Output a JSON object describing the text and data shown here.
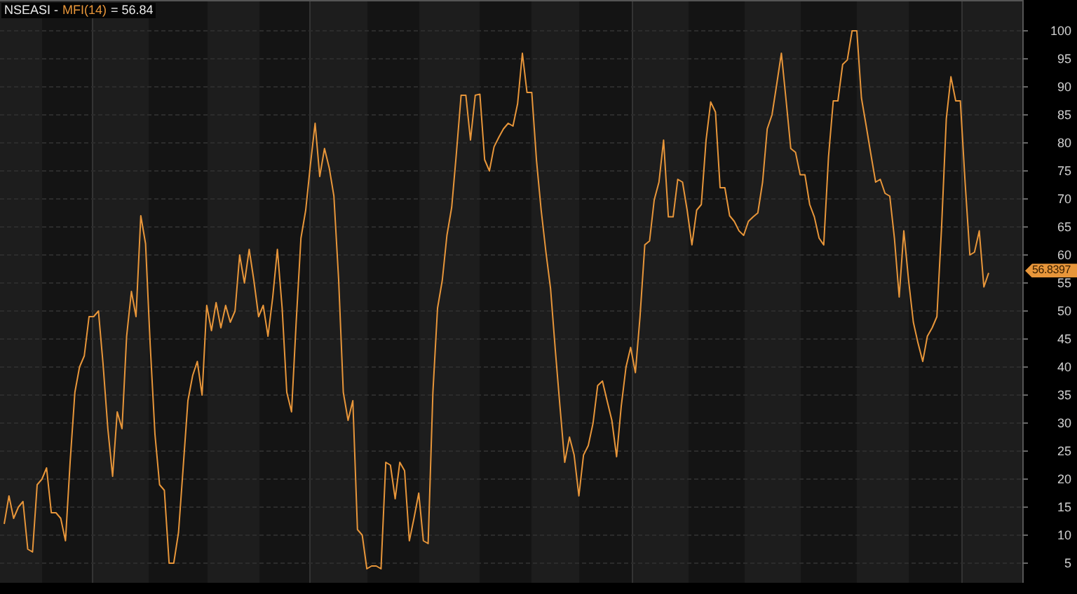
{
  "legend": {
    "symbol": "NSEASI -",
    "reading": "= 56.84"
  },
  "last_value_tag": "56.8397",
  "chart_data": {
    "type": "line",
    "grid": true,
    "ylim": [
      1.5,
      105.5
    ],
    "yticks": [
      5,
      10,
      15,
      20,
      25,
      30,
      35,
      40,
      45,
      50,
      55,
      60,
      65,
      70,
      75,
      80,
      85,
      90,
      95,
      100
    ],
    "series": [
      {
        "name": "MFI(14)",
        "color": "#e8963a",
        "values": [
          12,
          17,
          13,
          15,
          16,
          7.5,
          7,
          19,
          20,
          22,
          14,
          14,
          13,
          9,
          23,
          35.5,
          40,
          42,
          49,
          49,
          50,
          40.5,
          29,
          20.5,
          32,
          29,
          45.5,
          53.5,
          49,
          67,
          62,
          44,
          28,
          19,
          18,
          5,
          5,
          10.5,
          22,
          34,
          38.5,
          41,
          35,
          51,
          46.5,
          51.5,
          47,
          51,
          48,
          50,
          60,
          55,
          61,
          55.5,
          49,
          51,
          45.5,
          52.5,
          61,
          50.5,
          35.5,
          32,
          48,
          63,
          68,
          76,
          83.5,
          74,
          79,
          75.5,
          70.5,
          55.5,
          35.5,
          30.5,
          34,
          11,
          10,
          4,
          4.5,
          4.5,
          4,
          23,
          22.5,
          16.5,
          23,
          21.5,
          9,
          13,
          17.5,
          9,
          8.5,
          35.5,
          50.5,
          55.5,
          63.5,
          68.5,
          78,
          88.5,
          88.5,
          80.5,
          88.5,
          88.7,
          77,
          75,
          79.3,
          81,
          82.5,
          83.5,
          83,
          87,
          96,
          89,
          89,
          76.8,
          68,
          60.5,
          54,
          43,
          33,
          23,
          27.5,
          24.3,
          17,
          24.3,
          26,
          30,
          36.7,
          37.5,
          34,
          30.5,
          24,
          33,
          40,
          43.5,
          39,
          49,
          61.8,
          62.5,
          69.8,
          73,
          80.5,
          66.8,
          66.8,
          73.5,
          73,
          68,
          61.8,
          68,
          69,
          80.5,
          87.3,
          85.5,
          72,
          72,
          67,
          66,
          64.3,
          63.5,
          66,
          66.8,
          67.5,
          73,
          82.5,
          85,
          90.5,
          96,
          87.5,
          79,
          78.3,
          74.3,
          74.3,
          69,
          66.8,
          63,
          61.8,
          77.5,
          87.5,
          87.5,
          94,
          94.8,
          100,
          100,
          88,
          83,
          78,
          73,
          73.5,
          71,
          70.5,
          63,
          52.5,
          64.3,
          55.5,
          48,
          44.3,
          41,
          45.5,
          47,
          49,
          64.8,
          84.3,
          91.8,
          87.5,
          87.5,
          73,
          60,
          60.5,
          64.3,
          54.3,
          56.8
        ]
      }
    ]
  }
}
